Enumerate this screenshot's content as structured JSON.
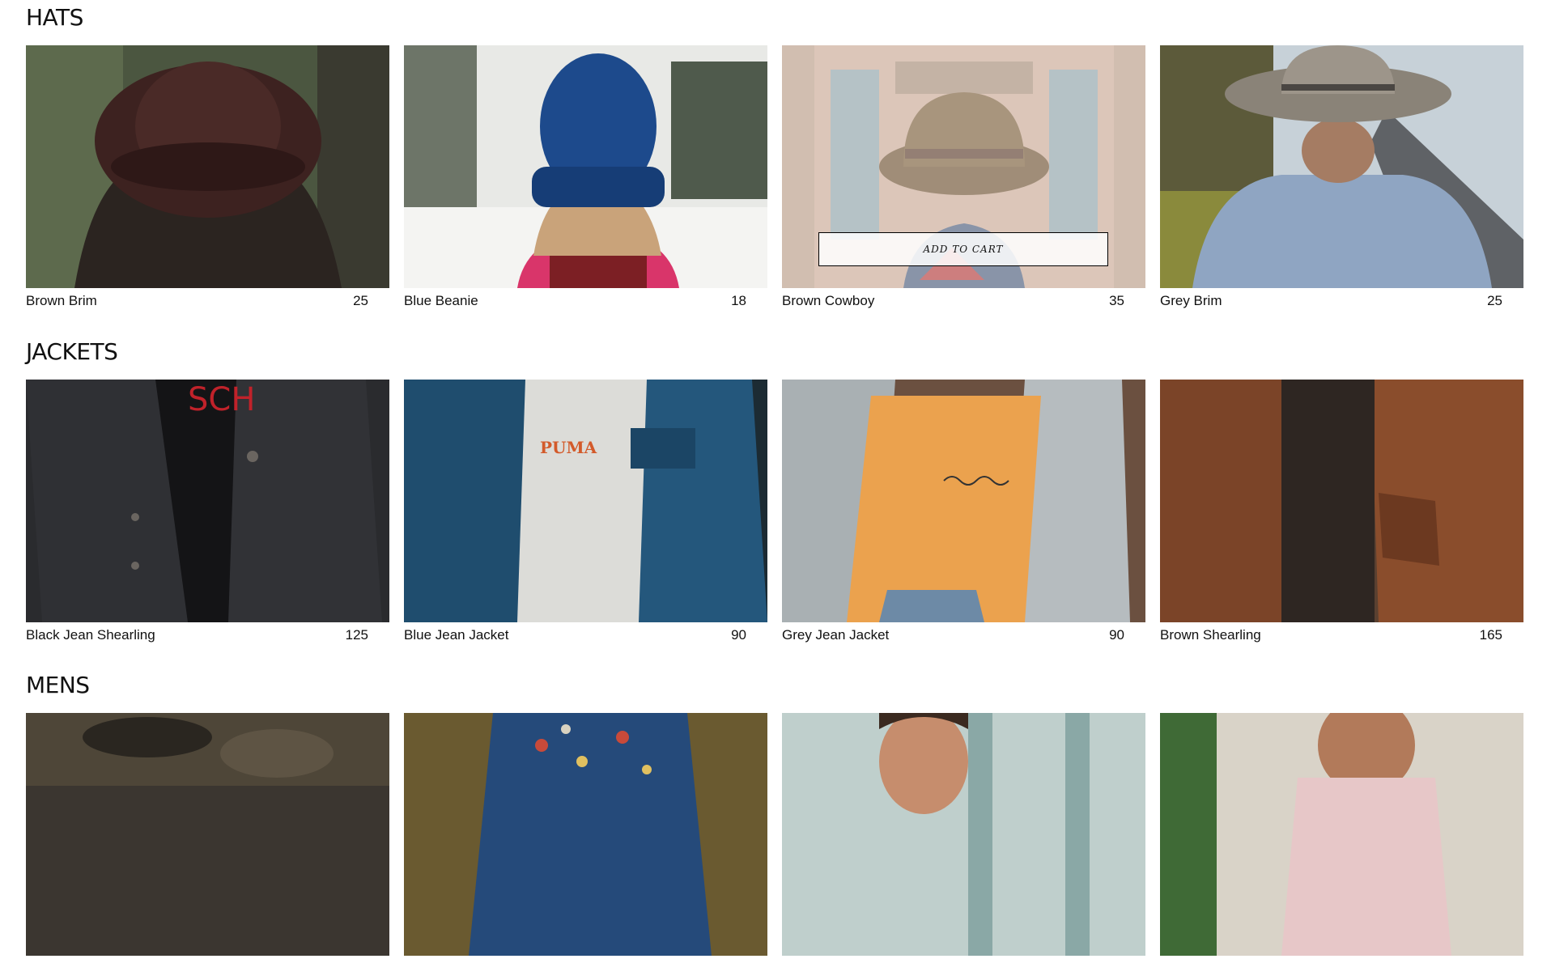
{
  "sections": [
    {
      "title": "HATS",
      "items": [
        {
          "name": "Brown Brim",
          "price": "25",
          "image": "brown-fedora-hat"
        },
        {
          "name": "Blue Beanie",
          "price": "18",
          "image": "blue-knit-beanie"
        },
        {
          "name": "Brown Cowboy",
          "price": "35",
          "image": "brown-cowboy-hat",
          "button": "ADD TO CART"
        },
        {
          "name": "Grey Brim",
          "price": "25",
          "image": "grey-brim-hat"
        }
      ]
    },
    {
      "title": "JACKETS",
      "items": [
        {
          "name": "Black Jean Shearling",
          "price": "125",
          "image": "black-denim-jacket"
        },
        {
          "name": "Blue Jean Jacket",
          "price": "90",
          "image": "blue-denim-jacket",
          "image_text": "PUMA"
        },
        {
          "name": "Grey Jean Jacket",
          "price": "90",
          "image": "grey-denim-jacket"
        },
        {
          "name": "Brown Shearling",
          "price": "165",
          "image": "brown-suede-jacket"
        }
      ]
    },
    {
      "title": "MENS",
      "items": [
        {
          "name": "",
          "price": "",
          "image": "camo-jacket"
        },
        {
          "name": "",
          "price": "",
          "image": "floral-shirt"
        },
        {
          "name": "",
          "price": "",
          "image": "smiling-man"
        },
        {
          "name": "",
          "price": "",
          "image": "pink-shirt"
        }
      ]
    }
  ]
}
